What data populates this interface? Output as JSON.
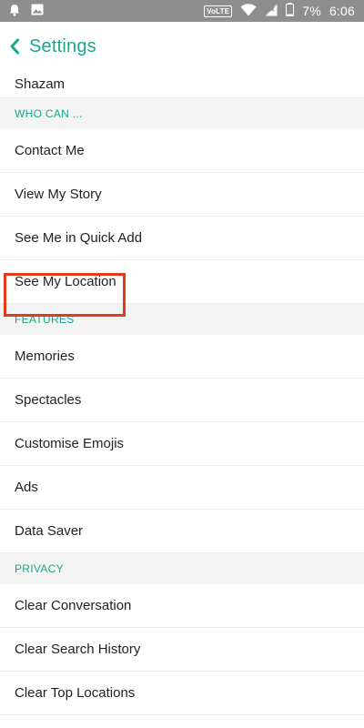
{
  "status_bar": {
    "volte": "VoLTE",
    "battery": "7%",
    "time": "6:06"
  },
  "header": {
    "title": "Settings"
  },
  "list": [
    {
      "kind": "item",
      "label": "Shazam"
    },
    {
      "kind": "section",
      "label": "WHO CAN ..."
    },
    {
      "kind": "item",
      "label": "Contact Me"
    },
    {
      "kind": "item",
      "label": "View My Story"
    },
    {
      "kind": "item",
      "label": "See Me in Quick Add"
    },
    {
      "kind": "item",
      "label": "See My Location"
    },
    {
      "kind": "section",
      "label": "FEATURES"
    },
    {
      "kind": "item",
      "label": "Memories"
    },
    {
      "kind": "item",
      "label": "Spectacles"
    },
    {
      "kind": "item",
      "label": "Customise Emojis"
    },
    {
      "kind": "item",
      "label": "Ads"
    },
    {
      "kind": "item",
      "label": "Data Saver"
    },
    {
      "kind": "section",
      "label": "PRIVACY"
    },
    {
      "kind": "item",
      "label": "Clear Conversation"
    },
    {
      "kind": "item",
      "label": "Clear Search History"
    },
    {
      "kind": "item",
      "label": "Clear Top Locations"
    }
  ],
  "colors": {
    "accent": "#17a88c",
    "highlight": "#e23a1e",
    "status_bar": "#8e8e8e",
    "section_bg": "#f3f3f3"
  }
}
